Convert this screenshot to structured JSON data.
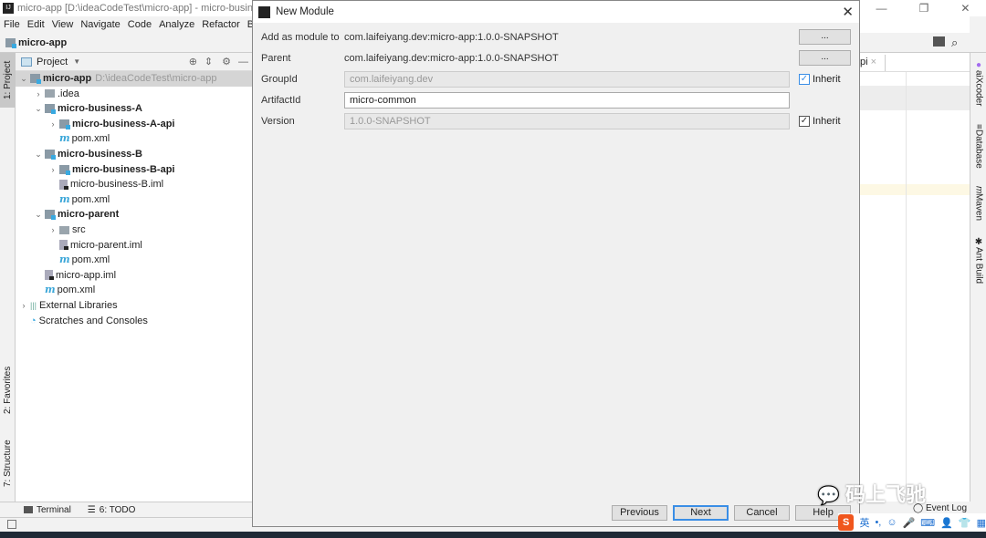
{
  "window": {
    "title": "micro-app [D:\\ideaCodeTest\\micro-app] - micro-busine"
  },
  "menu": [
    "File",
    "Edit",
    "View",
    "Navigate",
    "Code",
    "Analyze",
    "Refactor",
    "Bu"
  ],
  "navbar": {
    "project": "micro-app"
  },
  "left_stripe": {
    "project": "1: Project",
    "favorites": "2: Favorites",
    "structure": "7: Structure"
  },
  "project_panel": {
    "title": "Project",
    "tree": [
      {
        "label": "micro-app",
        "path": "D:\\ideaCodeTest\\micro-app",
        "level": 0,
        "icon": "module",
        "bold": true,
        "arrow": "down"
      },
      {
        "label": ".idea",
        "level": 1,
        "icon": "folder",
        "arrow": "right"
      },
      {
        "label": "micro-business-A",
        "level": 1,
        "icon": "module",
        "bold": true,
        "arrow": "down"
      },
      {
        "label": "micro-business-A-api",
        "level": 2,
        "icon": "module",
        "bold": true,
        "arrow": "right"
      },
      {
        "label": "pom.xml",
        "level": 2,
        "icon": "maven"
      },
      {
        "label": "micro-business-B",
        "level": 1,
        "icon": "module",
        "bold": true,
        "arrow": "down"
      },
      {
        "label": "micro-business-B-api",
        "level": 2,
        "icon": "module",
        "bold": true,
        "arrow": "right"
      },
      {
        "label": "micro-business-B.iml",
        "level": 2,
        "icon": "iml"
      },
      {
        "label": "pom.xml",
        "level": 2,
        "icon": "maven"
      },
      {
        "label": "micro-parent",
        "level": 1,
        "icon": "module",
        "bold": true,
        "arrow": "down"
      },
      {
        "label": "src",
        "level": 2,
        "icon": "folder",
        "arrow": "right"
      },
      {
        "label": "micro-parent.iml",
        "level": 2,
        "icon": "iml"
      },
      {
        "label": "pom.xml",
        "level": 2,
        "icon": "maven"
      },
      {
        "label": "micro-app.iml",
        "level": 1,
        "icon": "iml"
      },
      {
        "label": "pom.xml",
        "level": 1,
        "icon": "maven"
      },
      {
        "label": "External Libraries",
        "level": 0,
        "icon": "library",
        "arrow": "right"
      },
      {
        "label": "Scratches and Consoles",
        "level": 0,
        "icon": "scratch"
      }
    ]
  },
  "bottom_tools": {
    "terminal": "Terminal",
    "todo": "6: TODO"
  },
  "dialog": {
    "title": "New Module",
    "add_as_module_label": "Add as module to",
    "add_as_module_value": "com.laifeiyang.dev:micro-app:1.0.0-SNAPSHOT",
    "parent_label": "Parent",
    "parent_value": "com.laifeiyang.dev:micro-app:1.0.0-SNAPSHOT",
    "groupid_label": "GroupId",
    "groupid_value": "com.laifeiyang.dev",
    "artifactid_label": "ArtifactId",
    "artifactid_value": "micro-common",
    "version_label": "Version",
    "version_value": "1.0.0-SNAPSHOT",
    "browse": "...",
    "inherit": "Inherit",
    "groupid_inherit": true,
    "version_inherit": true,
    "buttons": {
      "previous": "Previous",
      "next": "Next",
      "cancel": "Cancel",
      "help": "Help"
    }
  },
  "editor": {
    "tab": "pi"
  },
  "right_stripe": {
    "aixcoder": "aiXcoder",
    "database": "Database",
    "maven": "Maven",
    "ant": "Ant Build"
  },
  "status": {
    "event_log": "Event Log"
  },
  "watermark": "码上飞驰",
  "ime": {
    "logo": "S",
    "lang": "英"
  },
  "colors": {
    "accent": "#3a8ee6",
    "module_badge": "#39a9e0",
    "ime": "#f0561d"
  }
}
